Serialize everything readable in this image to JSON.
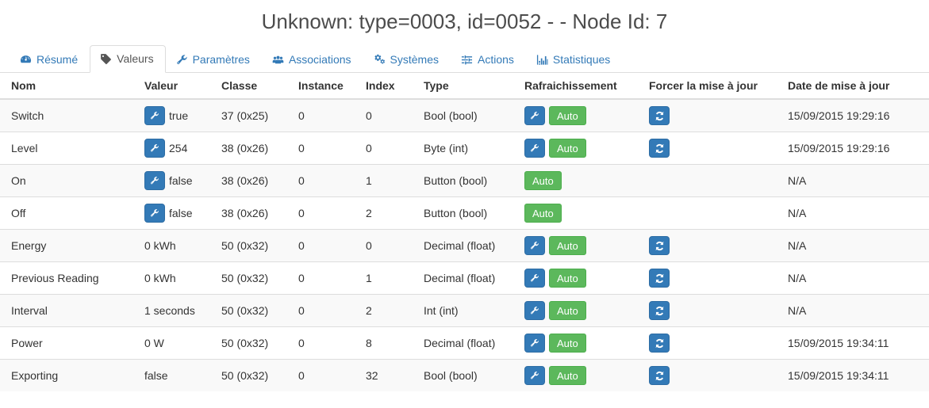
{
  "header": {
    "title": "Unknown: type=0003, id=0052 - - Node Id: 7"
  },
  "tabs": [
    {
      "label": "Résumé",
      "icon": "dashboard-icon",
      "active": false
    },
    {
      "label": "Valeurs",
      "icon": "tag-icon",
      "active": true
    },
    {
      "label": "Paramètres",
      "icon": "wrench-icon",
      "active": false
    },
    {
      "label": "Associations",
      "icon": "users-icon",
      "active": false
    },
    {
      "label": "Systèmes",
      "icon": "gears-icon",
      "active": false
    },
    {
      "label": "Actions",
      "icon": "sliders-icon",
      "active": false
    },
    {
      "label": "Statistiques",
      "icon": "bar-chart-icon",
      "active": false
    }
  ],
  "table": {
    "columns": [
      "Nom",
      "Valeur",
      "Classe",
      "Instance",
      "Index",
      "Type",
      "Rafraichissement",
      "Forcer la mise à jour",
      "Date de mise à jour"
    ],
    "auto_label": "Auto",
    "rows": [
      {
        "nom": "Switch",
        "valeur": "true",
        "has_value_edit": true,
        "classe": "37 (0x25)",
        "instance": "0",
        "index": "0",
        "type": "Bool (bool)",
        "has_refresh_edit": true,
        "has_auto": true,
        "has_force": true,
        "date": "15/09/2015 19:29:16"
      },
      {
        "nom": "Level",
        "valeur": "254",
        "has_value_edit": true,
        "classe": "38 (0x26)",
        "instance": "0",
        "index": "0",
        "type": "Byte (int)",
        "has_refresh_edit": true,
        "has_auto": true,
        "has_force": true,
        "date": "15/09/2015 19:29:16"
      },
      {
        "nom": "On",
        "valeur": "false",
        "has_value_edit": true,
        "classe": "38 (0x26)",
        "instance": "0",
        "index": "1",
        "type": "Button (bool)",
        "has_refresh_edit": false,
        "has_auto": true,
        "has_force": false,
        "date": "N/A"
      },
      {
        "nom": "Off",
        "valeur": "false",
        "has_value_edit": true,
        "classe": "38 (0x26)",
        "instance": "0",
        "index": "2",
        "type": "Button (bool)",
        "has_refresh_edit": false,
        "has_auto": true,
        "has_force": false,
        "date": "N/A"
      },
      {
        "nom": "Energy",
        "valeur": "0 kWh",
        "has_value_edit": false,
        "classe": "50 (0x32)",
        "instance": "0",
        "index": "0",
        "type": "Decimal (float)",
        "has_refresh_edit": true,
        "has_auto": true,
        "has_force": true,
        "date": "N/A"
      },
      {
        "nom": "Previous Reading",
        "valeur": "0 kWh",
        "has_value_edit": false,
        "classe": "50 (0x32)",
        "instance": "0",
        "index": "1",
        "type": "Decimal (float)",
        "has_refresh_edit": true,
        "has_auto": true,
        "has_force": true,
        "date": "N/A"
      },
      {
        "nom": "Interval",
        "valeur": "1 seconds",
        "has_value_edit": false,
        "classe": "50 (0x32)",
        "instance": "0",
        "index": "2",
        "type": "Int (int)",
        "has_refresh_edit": true,
        "has_auto": true,
        "has_force": true,
        "date": "N/A"
      },
      {
        "nom": "Power",
        "valeur": "0 W",
        "has_value_edit": false,
        "classe": "50 (0x32)",
        "instance": "0",
        "index": "8",
        "type": "Decimal (float)",
        "has_refresh_edit": true,
        "has_auto": true,
        "has_force": true,
        "date": "15/09/2015 19:34:11"
      },
      {
        "nom": "Exporting",
        "valeur": "false",
        "has_value_edit": false,
        "classe": "50 (0x32)",
        "instance": "0",
        "index": "32",
        "type": "Bool (bool)",
        "has_refresh_edit": true,
        "has_auto": true,
        "has_force": true,
        "date": "15/09/2015 19:34:11"
      }
    ]
  },
  "colors": {
    "primary": "#337ab7",
    "success": "#5cb85c",
    "text": "#333333",
    "border": "#dddddd",
    "stripe": "#f9f9f9"
  }
}
